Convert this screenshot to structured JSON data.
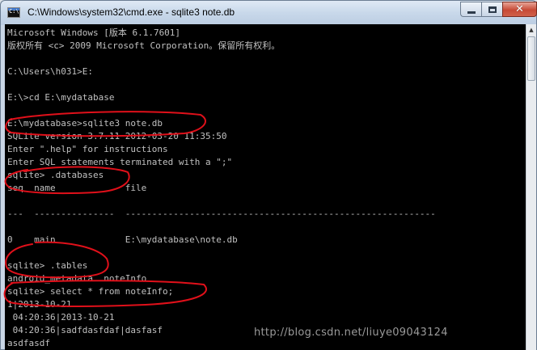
{
  "window": {
    "title": "C:\\Windows\\system32\\cmd.exe - sqlite3  note.db",
    "app_icon": "console-icon",
    "prompt_glyph": "C:\\",
    "close_glyph": "✕"
  },
  "console": {
    "lines": [
      "Microsoft Windows [版本 6.1.7601]",
      "版权所有 <c> 2009 Microsoft Corporation。保留所有权利。",
      "",
      "C:\\Users\\h031>E:",
      "",
      "E:\\>cd E:\\mydatabase",
      "",
      "E:\\mydatabase>sqlite3 note.db",
      "SQLite version 3.7.11 2012-03-20 11:35:50",
      "Enter \".help\" for instructions",
      "Enter SQL statements terminated with a \";\"",
      "sqlite> .databases",
      "seq  name             file",
      "",
      "---  ---------------  ----------------------------------------------------------",
      "",
      "0    main             E:\\mydatabase\\note.db",
      "",
      "sqlite> .tables",
      "android_metadata  noteInfo",
      "sqlite> select * from noteInfo;",
      "1|2013-10-21",
      " 04:20:36|2013-10-21",
      " 04:20:36|sadfdasfdaf|dasfasf",
      "asdfasdf"
    ]
  },
  "annotations": {
    "color": "#e0101a"
  },
  "watermark": {
    "text": "http://blog.csdn.net/liuye09043124"
  }
}
